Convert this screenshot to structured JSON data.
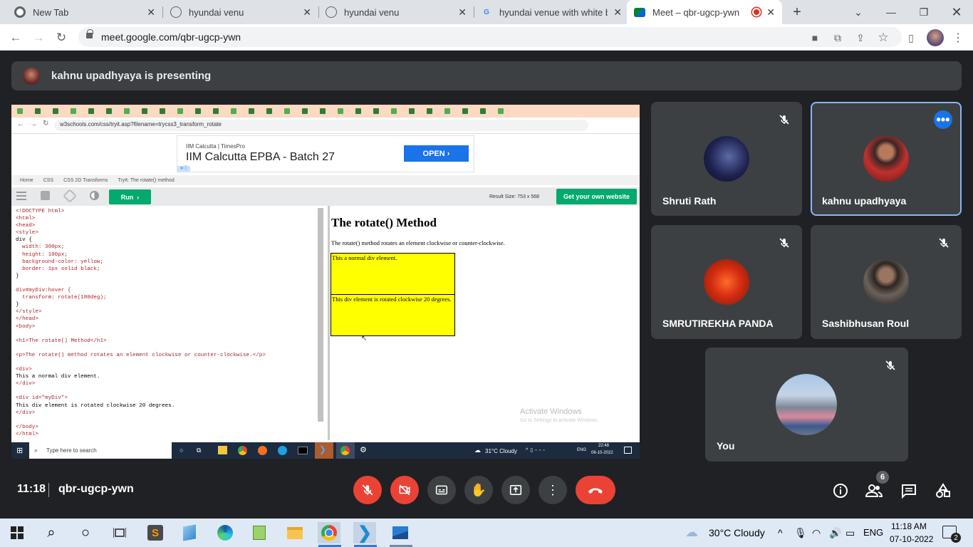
{
  "browser": {
    "tabs": [
      {
        "label": "New Tab",
        "icon": "chrome-icon"
      },
      {
        "label": "hyundai venu",
        "icon": "globe-icon"
      },
      {
        "label": "hyundai venu",
        "icon": "globe-icon"
      },
      {
        "label": "hyundai venue with white ba",
        "icon": "google-icon"
      },
      {
        "label": "Meet – qbr-ugcp-ywn",
        "icon": "meet-icon"
      }
    ],
    "new_tab": "+",
    "url": "meet.google.com/qbr-ugcp-ywn"
  },
  "meet": {
    "presenting_text": "kahnu upadhyaya is presenting",
    "meeting_code": "qbr-ugcp-ywn",
    "time": "11:18",
    "participants_count": "6",
    "participants": [
      {
        "name": "Shruti Rath",
        "muted": true
      },
      {
        "name": "kahnu upadhyaya",
        "muted": false,
        "speaking": true
      },
      {
        "name": "SMRUTIREKHA PANDA",
        "muted": true
      },
      {
        "name": "Sashibhusan Roul",
        "muted": true
      },
      {
        "name": "You",
        "muted": true
      }
    ],
    "more_dots": "•••",
    "colors": {
      "accent": "#1a73e8",
      "danger": "#ea4335",
      "surface": "#3c4043",
      "background": "#202124"
    }
  },
  "shared": {
    "url": "w3schools.com/css/tryit.asp?filename=trycss3_transform_rotate",
    "ad": {
      "brand": "IIM Calcutta | TimesPro",
      "headline": "IIM Calcutta EPBA - Batch 27",
      "cta": "OPEN"
    },
    "breadcrumb": [
      "Home",
      "CSS",
      "CSS 2D Transforms",
      "TryIt: The rotate() method"
    ],
    "run_label": "Run",
    "result_size": "Result Size: 753 x 568",
    "get_website": "Get your own website",
    "code_lines": [
      "<!DOCTYPE html>",
      "<html>",
      "<head>",
      "<style>",
      "div {",
      "  width: 300px;",
      "  height: 100px;",
      "  background-color: yellow;",
      "  border: 1px solid black;",
      "}",
      "",
      "div#myDiv:hover {",
      "  transform: rotate(180deg);",
      "}",
      "</style>",
      "</head>",
      "<body>",
      "",
      "<h1>The rotate() Method</h1>",
      "",
      "<p>The rotate() method rotates an element clockwise or counter-clockwise.</p>",
      "",
      "<div>",
      "This a normal div element.",
      "</div>",
      "",
      "<div id=\"myDiv\">",
      "This div element is rotated clockwise 20 degrees.",
      "</div>",
      "",
      "</body>",
      "</html>"
    ],
    "result": {
      "h1": "The rotate() Method",
      "p": "The rotate() method rotates an element clockwise or counter-clockwise.",
      "div1": "This a normal div element.",
      "div2": "This div element is rotated clockwise 20 degrees."
    },
    "activate_title": "Activate Windows",
    "activate_sub": "Go to Settings to activate Windows.",
    "taskbar_search": "Type here to search",
    "weather": "31°C  Cloudy",
    "lang": "ENG",
    "clock_time": "22:48",
    "clock_date": "06-10-2022"
  },
  "taskbar": {
    "weather": "30°C  Cloudy",
    "lang": "ENG",
    "time": "11:18 AM",
    "date": "07-10-2022",
    "notifications": "2"
  }
}
